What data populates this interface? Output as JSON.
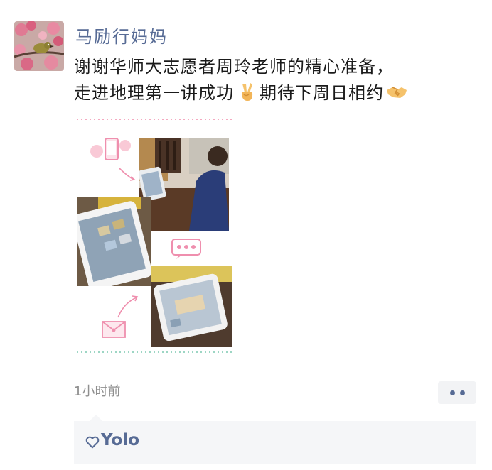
{
  "post": {
    "author": "马励行妈妈",
    "text_line1": "谢谢华师大志愿者周玲老师的精心准备，",
    "text_line2a": "走进地理第一讲成功",
    "text_line2b": "期待下周日相约",
    "time": "1小时前"
  },
  "likes": {
    "names": "Yolo"
  },
  "colors": {
    "name_link": "#576b95",
    "body_text": "#1a1a1a",
    "time_text": "#8f8f8f",
    "likes_bg": "#f5f6f8",
    "collage_pink": "#f4a9c0"
  },
  "icons": {
    "avatar": "plum-blossom-bird-avatar",
    "victory": "victory-hand-emoji",
    "handshake": "handshake-emoji",
    "like": "heart-outline-icon",
    "more": "two-dots-more-icon"
  }
}
